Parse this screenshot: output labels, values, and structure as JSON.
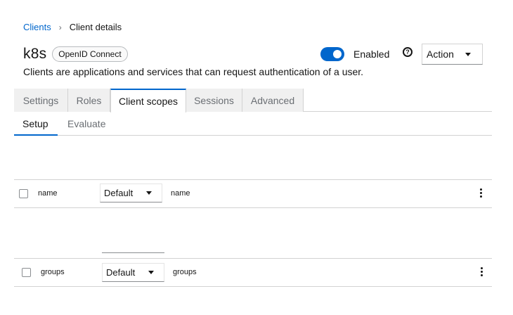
{
  "breadcrumb": {
    "parent": "Clients",
    "separator": "›",
    "current": "Client details"
  },
  "client": {
    "name": "k8s",
    "protocol_badge": "OpenID Connect",
    "description": "Clients are applications and services that can request authentication of a user."
  },
  "header_controls": {
    "enabled_label": "Enabled",
    "enabled": true,
    "help_icon": "question-circle-icon",
    "action_label": "Action"
  },
  "tabs": [
    {
      "label": "Settings",
      "active": false
    },
    {
      "label": "Roles",
      "active": false
    },
    {
      "label": "Client scopes",
      "active": true
    },
    {
      "label": "Sessions",
      "active": false
    },
    {
      "label": "Advanced",
      "active": false
    }
  ],
  "subtabs": [
    {
      "label": "Setup",
      "active": true
    },
    {
      "label": "Evaluate",
      "active": false
    }
  ],
  "scopes": [
    {
      "name": "name",
      "assigned_type": "Default",
      "description": "name"
    },
    {
      "name": "groups",
      "assigned_type": "Default",
      "description": "groups"
    }
  ],
  "colors": {
    "accent": "#0066cc",
    "border": "#d2d2d2",
    "inactive_tab_bg": "#f0f0f0"
  }
}
